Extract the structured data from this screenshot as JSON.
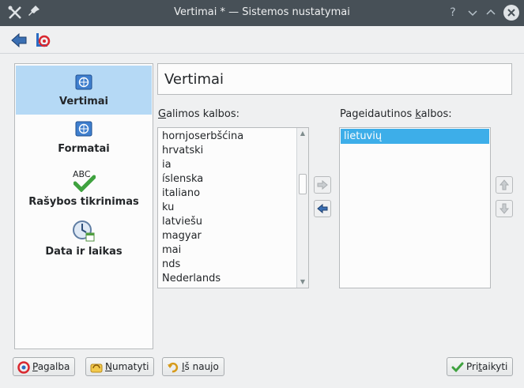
{
  "window": {
    "title": "Vertimai * — Sistemos nustatymai",
    "help_glyph": "?",
    "minimize_glyph": "⌄",
    "maximize_glyph": "⌃",
    "close_glyph": "✕",
    "pin_glyph": "✕"
  },
  "toolbar": {
    "back_icon": "back-arrow-icon",
    "overview_icon": "overview-icon"
  },
  "sidebar": {
    "items": [
      {
        "label": "Vertimai",
        "icon": "flag-icon",
        "active": true
      },
      {
        "label": "Formatai",
        "icon": "flag-icon",
        "active": false
      },
      {
        "label": "Rašybos tikrinimas",
        "icon": "spellcheck-icon",
        "icon_text": "ABC",
        "active": false
      },
      {
        "label": "Data ir laikas",
        "icon": "clock-icon",
        "active": false
      }
    ]
  },
  "page": {
    "title": "Vertimai",
    "available_label_prefix": "",
    "available_label_key": "G",
    "available_label_rest": "alimos kalbos:",
    "preferred_label_prefix": "Pageidautinos ",
    "preferred_label_key": "k",
    "preferred_label_rest": "albos:",
    "available_languages": [
      "hornjoserbšćina",
      "hrvatski",
      "ia",
      "íslenska",
      "italiano",
      "ku",
      "latviešu",
      "magyar",
      "mai",
      "nds",
      "Nederlands"
    ],
    "preferred_languages": [
      "lietuvių"
    ]
  },
  "buttons": {
    "help_key": "P",
    "help_rest": "agalba",
    "defaults_key": "N",
    "defaults_rest": "umatyti",
    "reset_key": "I",
    "reset_rest": "š naujo",
    "apply_prefix": "Pri",
    "apply_key": "t",
    "apply_rest": "aikyti"
  },
  "colors": {
    "titlebar": "#475057",
    "selection": "#3daee9",
    "sidebar_active": "#b5d9f5"
  }
}
